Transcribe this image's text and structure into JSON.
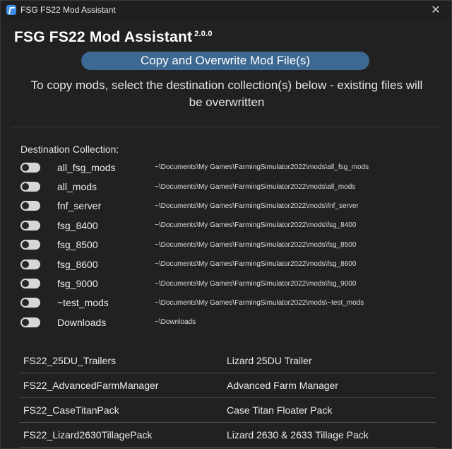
{
  "window": {
    "title": "FSG FS22 Mod Assistant",
    "close_glyph": "✕"
  },
  "header": {
    "app_title": "FSG FS22 Mod Assistant",
    "version": "2.0.0"
  },
  "action": {
    "copy_button_label": "Copy and Overwrite Mod File(s)"
  },
  "instructions": "To copy mods, select the destination collection(s) below - existing files will be overwritten",
  "destination": {
    "label": "Destination Collection:",
    "collections": [
      {
        "name": "all_fsg_mods",
        "path": "~\\Documents\\My Games\\FarmingSimulator2022\\mods\\all_fsg_mods",
        "enabled": false
      },
      {
        "name": "all_mods",
        "path": "~\\Documents\\My Games\\FarmingSimulator2022\\mods\\all_mods",
        "enabled": false
      },
      {
        "name": "fnf_server",
        "path": "~\\Documents\\My Games\\FarmingSimulator2022\\mods\\fnf_server",
        "enabled": false
      },
      {
        "name": "fsg_8400",
        "path": "~\\Documents\\My Games\\FarmingSimulator2022\\mods\\fsg_8400",
        "enabled": false
      },
      {
        "name": "fsg_8500",
        "path": "~\\Documents\\My Games\\FarmingSimulator2022\\mods\\fsg_8500",
        "enabled": false
      },
      {
        "name": "fsg_8600",
        "path": "~\\Documents\\My Games\\FarmingSimulator2022\\mods\\fsg_8600",
        "enabled": false
      },
      {
        "name": "fsg_9000",
        "path": "~\\Documents\\My Games\\FarmingSimulator2022\\mods\\fsg_9000",
        "enabled": false
      },
      {
        "name": "~test_mods",
        "path": "~\\Documents\\My Games\\FarmingSimulator2022\\mods\\~test_mods",
        "enabled": false
      },
      {
        "name": "Downloads",
        "path": "~\\Downloads",
        "enabled": false
      }
    ]
  },
  "mods": [
    {
      "file": "FS22_25DU_Trailers",
      "title": "Lizard 25DU Trailer"
    },
    {
      "file": "FS22_AdvancedFarmManager",
      "title": "Advanced Farm Manager"
    },
    {
      "file": "FS22_CaseTitanPack",
      "title": "Case Titan Floater Pack"
    },
    {
      "file": "FS22_Lizard2630TillagePack",
      "title": "Lizard 2630 & 2633 Tillage Pack"
    }
  ]
}
